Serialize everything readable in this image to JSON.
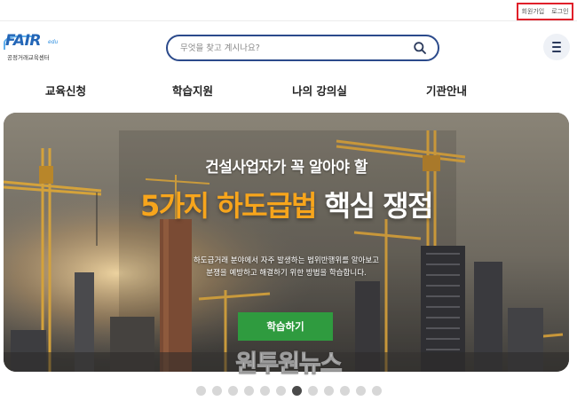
{
  "utility": {
    "signup": "회원가입",
    "login": "로그인"
  },
  "logo": {
    "word": "FAIR",
    "edu": "edu",
    "subtitle": "공정거래교육센터"
  },
  "search": {
    "placeholder": "무엇을 찾고 계시나요?"
  },
  "nav": [
    {
      "label": "교육신청"
    },
    {
      "label": "학습지원"
    },
    {
      "label": "나의 강의실"
    },
    {
      "label": "기관안내"
    }
  ],
  "hero": {
    "subtitle": "건설사업자가 꼭 알아야 할",
    "title_highlight": "5가지 하도급법",
    "title_rest": "핵심 쟁점",
    "desc_line1": "하도급거래 분야에서 자주 발생하는 법위반행위를 알아보고",
    "desc_line2": "분쟁을 예방하고 해결하기 위한 방법을 학습합니다.",
    "button": "학습하기"
  },
  "watermark": "원투원뉴스",
  "pager": {
    "total": 12,
    "active": 7
  },
  "colors": {
    "accent": "#2b4a8b",
    "highlight": "#f7a51c",
    "button": "#2f9b3f",
    "util_border": "#e0202a"
  }
}
